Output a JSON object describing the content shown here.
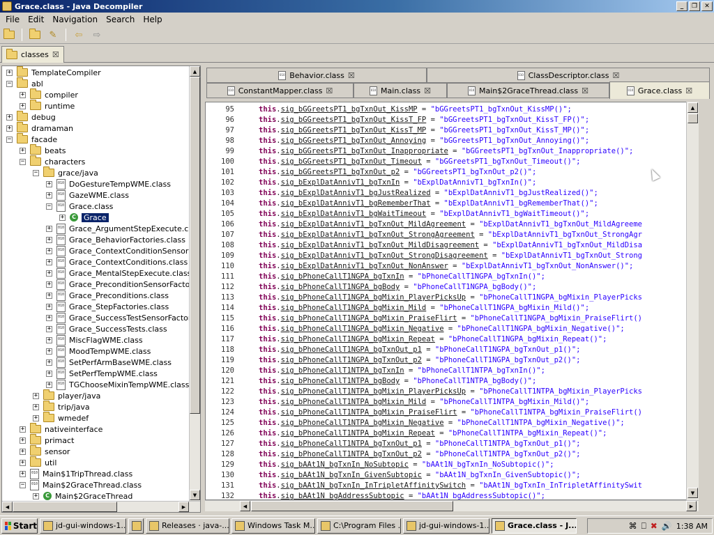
{
  "window": {
    "title": "Grace.class - Java Decompiler",
    "controls": [
      "_",
      "❐",
      "✕"
    ]
  },
  "menu": [
    "File",
    "Edit",
    "Navigation",
    "Search",
    "Help"
  ],
  "file_tab": {
    "label": "classes"
  },
  "tree": [
    {
      "d": 0,
      "e": "+",
      "i": "folder",
      "t": "TemplateCompiler"
    },
    {
      "d": 0,
      "e": "−",
      "i": "folder",
      "t": "abl"
    },
    {
      "d": 1,
      "e": "+",
      "i": "folder",
      "t": "compiler"
    },
    {
      "d": 1,
      "e": "+",
      "i": "folder",
      "t": "runtime"
    },
    {
      "d": 0,
      "e": "+",
      "i": "folder",
      "t": "debug"
    },
    {
      "d": 0,
      "e": "+",
      "i": "folder",
      "t": "dramaman"
    },
    {
      "d": 0,
      "e": "−",
      "i": "folder",
      "t": "facade"
    },
    {
      "d": 1,
      "e": "+",
      "i": "folder",
      "t": "beats"
    },
    {
      "d": 1,
      "e": "−",
      "i": "folder",
      "t": "characters"
    },
    {
      "d": 2,
      "e": "−",
      "i": "folder",
      "t": "grace/java"
    },
    {
      "d": 3,
      "e": "+",
      "i": "file",
      "t": "DoGestureTempWME.class"
    },
    {
      "d": 3,
      "e": "+",
      "i": "file",
      "t": "GazeWME.class"
    },
    {
      "d": 3,
      "e": "−",
      "i": "file",
      "t": "Grace.class"
    },
    {
      "d": 4,
      "e": "+",
      "i": "class",
      "t": "Grace",
      "sel": true
    },
    {
      "d": 3,
      "e": "+",
      "i": "file",
      "t": "Grace_ArgumentStepExecute.class"
    },
    {
      "d": 3,
      "e": "+",
      "i": "file",
      "t": "Grace_BehaviorFactories.class"
    },
    {
      "d": 3,
      "e": "+",
      "i": "file",
      "t": "Grace_ContextConditionSensorFac"
    },
    {
      "d": 3,
      "e": "+",
      "i": "file",
      "t": "Grace_ContextConditions.class"
    },
    {
      "d": 3,
      "e": "+",
      "i": "file",
      "t": "Grace_MentalStepExecute.class"
    },
    {
      "d": 3,
      "e": "+",
      "i": "file",
      "t": "Grace_PreconditionSensorFactories"
    },
    {
      "d": 3,
      "e": "+",
      "i": "file",
      "t": "Grace_Preconditions.class"
    },
    {
      "d": 3,
      "e": "+",
      "i": "file",
      "t": "Grace_StepFactories.class"
    },
    {
      "d": 3,
      "e": "+",
      "i": "file",
      "t": "Grace_SuccessTestSensorFactories"
    },
    {
      "d": 3,
      "e": "+",
      "i": "file",
      "t": "Grace_SuccessTests.class"
    },
    {
      "d": 3,
      "e": "+",
      "i": "file",
      "t": "MiscFlagWME.class"
    },
    {
      "d": 3,
      "e": "+",
      "i": "file",
      "t": "MoodTempWME.class"
    },
    {
      "d": 3,
      "e": "+",
      "i": "file",
      "t": "SetPerfArmBaseWME.class"
    },
    {
      "d": 3,
      "e": "+",
      "i": "file",
      "t": "SetPerfTempWME.class"
    },
    {
      "d": 3,
      "e": "+",
      "i": "file",
      "t": "TGChooseMixinTempWME.class"
    },
    {
      "d": 2,
      "e": "+",
      "i": "folder",
      "t": "player/java"
    },
    {
      "d": 2,
      "e": "+",
      "i": "folder",
      "t": "trip/java"
    },
    {
      "d": 2,
      "e": "+",
      "i": "folder",
      "t": "wmedef"
    },
    {
      "d": 1,
      "e": "+",
      "i": "folder",
      "t": "nativeinterface"
    },
    {
      "d": 1,
      "e": "+",
      "i": "folder",
      "t": "primact"
    },
    {
      "d": 1,
      "e": "+",
      "i": "folder",
      "t": "sensor"
    },
    {
      "d": 1,
      "e": "+",
      "i": "folder",
      "t": "util"
    },
    {
      "d": 1,
      "e": "+",
      "i": "file",
      "t": "Main$1TripThread.class"
    },
    {
      "d": 1,
      "e": "−",
      "i": "file",
      "t": "Main$2GraceThread.class"
    },
    {
      "d": 2,
      "e": "+",
      "i": "class",
      "t": "Main$2GraceThread"
    }
  ],
  "editor_tabs_row1": [
    {
      "label": "Behavior.class"
    },
    {
      "label": "ClassDescriptor.class"
    }
  ],
  "editor_tabs_row2": [
    {
      "label": "ConstantMapper.class"
    },
    {
      "label": "Main.class"
    },
    {
      "label": "Main$2GraceThread.class"
    },
    {
      "label": "Grace.class",
      "active": true
    }
  ],
  "code": [
    {
      "n": "95",
      "f": "sig_bGGreetsPT1_bgTxnOut_KissMP",
      "s": "\"bGGreetsPT1_bgTxnOut_KissMP()\";"
    },
    {
      "n": "96",
      "f": "sig_bGGreetsPT1_bgTxnOut_KissT_FP",
      "s": "\"bGGreetsPT1_bgTxnOut_KissT_FP()\";"
    },
    {
      "n": "97",
      "f": "sig_bGGreetsPT1_bgTxnOut_KissT_MP",
      "s": "\"bGGreetsPT1_bgTxnOut_KissT_MP()\";"
    },
    {
      "n": "98",
      "f": "sig_bGGreetsPT1_bgTxnOut_Annoying",
      "s": "\"bGGreetsPT1_bgTxnOut_Annoying()\";"
    },
    {
      "n": "99",
      "f": "sig_bGGreetsPT1_bgTxnOut_Inappropriate",
      "s": "\"bGGreetsPT1_bgTxnOut_Inappropriate()\";"
    },
    {
      "n": "100",
      "f": "sig_bGGreetsPT1_bgTxnOut_Timeout",
      "s": "\"bGGreetsPT1_bgTxnOut_Timeout()\";"
    },
    {
      "n": "101",
      "f": "sig_bGGreetsPT1_bgTxnOut_p2",
      "s": "\"bGGreetsPT1_bgTxnOut_p2()\";"
    },
    {
      "n": "102",
      "f": "sig_bExplDatAnnivT1_bgTxnIn",
      "s": "\"bExplDatAnnivT1_bgTxnIn()\";"
    },
    {
      "n": "103",
      "f": "sig_bExplDatAnnivT1_bgJustRealized",
      "s": "\"bExplDatAnnivT1_bgJustRealized()\";"
    },
    {
      "n": "104",
      "f": "sig_bExplDatAnnivT1_bgRememberThat",
      "s": "\"bExplDatAnnivT1_bgRememberThat()\";"
    },
    {
      "n": "105",
      "f": "sig_bExplDatAnnivT1_bgWaitTimeout",
      "s": "\"bExplDatAnnivT1_bgWaitTimeout()\";"
    },
    {
      "n": "106",
      "f": "sig_bExplDatAnnivT1_bgTxnOut_MildAgreement",
      "s": "\"bExplDatAnnivT1_bgTxnOut_MildAgreeme"
    },
    {
      "n": "107",
      "f": "sig_bExplDatAnnivT1_bgTxnOut_StrongAgreement",
      "s": "\"bExplDatAnnivT1_bgTxnOut_StrongAgr"
    },
    {
      "n": "108",
      "f": "sig_bExplDatAnnivT1_bgTxnOut_MildDisagreement",
      "s": "\"bExplDatAnnivT1_bgTxnOut_MildDisa"
    },
    {
      "n": "109",
      "f": "sig_bExplDatAnnivT1_bgTxnOut_StrongDisagreement",
      "s": "\"bExplDatAnnivT1_bgTxnOut_Strong"
    },
    {
      "n": "110",
      "f": "sig_bExplDatAnnivT1_bgTxnOut_NonAnswer",
      "s": "\"bExplDatAnnivT1_bgTxnOut_NonAnswer()\";"
    },
    {
      "n": "111",
      "f": "sig_bPhoneCallT1NGPA_bgTxnIn",
      "s": "\"bPhoneCallT1NGPA_bgTxnIn()\";"
    },
    {
      "n": "112",
      "f": "sig_bPhoneCallT1NGPA_bgBody",
      "s": "\"bPhoneCallT1NGPA_bgBody()\";"
    },
    {
      "n": "113",
      "f": "sig_bPhoneCallT1NGPA_bgMixin_PlayerPicksUp",
      "s": "\"bPhoneCallT1NGPA_bgMixin_PlayerPicks"
    },
    {
      "n": "114",
      "f": "sig_bPhoneCallT1NGPA_bgMixin_Mild",
      "s": "\"bPhoneCallT1NGPA_bgMixin_Mild()\";"
    },
    {
      "n": "115",
      "f": "sig_bPhoneCallT1NGPA_bgMixin_PraiseFlirt",
      "s": "\"bPhoneCallT1NGPA_bgMixin_PraiseFlirt()"
    },
    {
      "n": "116",
      "f": "sig_bPhoneCallT1NGPA_bgMixin_Negative",
      "s": "\"bPhoneCallT1NGPA_bgMixin_Negative()\";"
    },
    {
      "n": "117",
      "f": "sig_bPhoneCallT1NGPA_bgMixin_Repeat",
      "s": "\"bPhoneCallT1NGPA_bgMixin_Repeat()\";"
    },
    {
      "n": "118",
      "f": "sig_bPhoneCallT1NGPA_bgTxnOut_p1",
      "s": "\"bPhoneCallT1NGPA_bgTxnOut_p1()\";"
    },
    {
      "n": "119",
      "f": "sig_bPhoneCallT1NGPA_bgTxnOut_p2",
      "s": "\"bPhoneCallT1NGPA_bgTxnOut_p2()\";"
    },
    {
      "n": "120",
      "f": "sig_bPhoneCallT1NTPA_bgTxnIn",
      "s": "\"bPhoneCallT1NTPA_bgTxnIn()\";"
    },
    {
      "n": "121",
      "f": "sig_bPhoneCallT1NTPA_bgBody",
      "s": "\"bPhoneCallT1NTPA_bgBody()\";"
    },
    {
      "n": "122",
      "f": "sig_bPhoneCallT1NTPA_bgMixin_PlayerPicksUp",
      "s": "\"bPhoneCallT1NTPA_bgMixin_PlayerPicks"
    },
    {
      "n": "123",
      "f": "sig_bPhoneCallT1NTPA_bgMixin_Mild",
      "s": "\"bPhoneCallT1NTPA_bgMixin_Mild()\";"
    },
    {
      "n": "124",
      "f": "sig_bPhoneCallT1NTPA_bgMixin_PraiseFlirt",
      "s": "\"bPhoneCallT1NTPA_bgMixin_PraiseFlirt()"
    },
    {
      "n": "125",
      "f": "sig_bPhoneCallT1NTPA_bgMixin_Negative",
      "s": "\"bPhoneCallT1NTPA_bgMixin_Negative()\";"
    },
    {
      "n": "126",
      "f": "sig_bPhoneCallT1NTPA_bgMixin_Repeat",
      "s": "\"bPhoneCallT1NTPA_bgMixin_Repeat()\";"
    },
    {
      "n": "127",
      "f": "sig_bPhoneCallT1NTPA_bgTxnOut_p1",
      "s": "\"bPhoneCallT1NTPA_bgTxnOut_p1()\";"
    },
    {
      "n": "128",
      "f": "sig_bPhoneCallT1NTPA_bgTxnOut_p2",
      "s": "\"bPhoneCallT1NTPA_bgTxnOut_p2()\";"
    },
    {
      "n": "129",
      "f": "sig_bAAt1N_bgTxnIn_NoSubtopic",
      "s": "\"bAAt1N_bgTxnIn_NoSubtopic()\";"
    },
    {
      "n": "130",
      "f": "sig_bAAt1N_bgTxnIn_GivenSubtopic",
      "s": "\"bAAt1N_bgTxnIn_GivenSubtopic()\";"
    },
    {
      "n": "131",
      "f": "sig_bAAt1N_bgTxnIn_InTripletAffinitySwitch",
      "s": "\"bAAt1N_bgTxnIn_InTripletAffinitySwit"
    },
    {
      "n": "132",
      "f": "sig_bAAt1N_bgAddressSubtopic",
      "s": "\"bAAt1N_bgAddressSubtopic()\";"
    }
  ],
  "code_keyword": "this",
  "taskbar": {
    "start": "Start",
    "items": [
      {
        "label": "jd-gui-windows-1...",
        "w": 124
      },
      {
        "label": "",
        "w": 22
      },
      {
        "label": "Releases · java-...",
        "w": 120
      },
      {
        "label": "Windows Task M...",
        "w": 120
      },
      {
        "label": "C:\\Program Files ...",
        "w": 120
      },
      {
        "label": "jd-gui-windows-1...",
        "w": 124
      },
      {
        "label": "Grace.class - J...",
        "w": 122,
        "active": true
      }
    ],
    "clock": "1:38 AM"
  }
}
